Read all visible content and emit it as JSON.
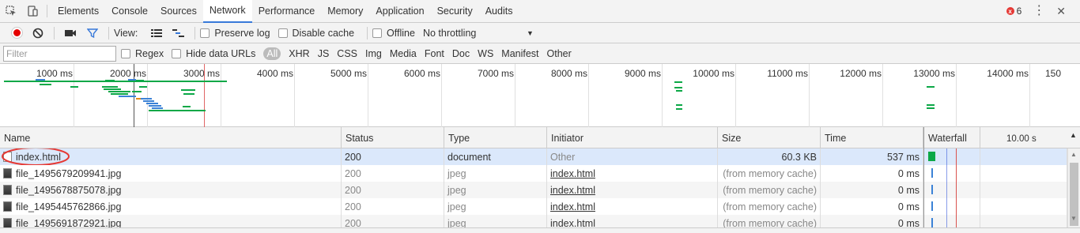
{
  "devtools_tabs": [
    "Elements",
    "Console",
    "Sources",
    "Network",
    "Performance",
    "Memory",
    "Application",
    "Security",
    "Audits"
  ],
  "active_tab": "Network",
  "error_count": "6",
  "error_mark": "x",
  "toolbar": {
    "view_label": "View:",
    "preserve_log": "Preserve log",
    "disable_cache": "Disable cache",
    "offline": "Offline",
    "throttling": "No throttling"
  },
  "filter": {
    "placeholder": "Filter",
    "regex": "Regex",
    "hide_data_urls": "Hide data URLs",
    "types": [
      "All",
      "XHR",
      "JS",
      "CSS",
      "Img",
      "Media",
      "Font",
      "Doc",
      "WS",
      "Manifest",
      "Other"
    ],
    "active_type": "All"
  },
  "overview": {
    "tick_labels": [
      "1000 ms",
      "2000 ms",
      "3000 ms",
      "4000 ms",
      "5000 ms",
      "6000 ms",
      "7000 ms",
      "8000 ms",
      "9000 ms",
      "10000 ms",
      "11000 ms",
      "12000 ms",
      "13000 ms",
      "14000 ms",
      "150"
    ]
  },
  "table": {
    "columns": [
      "Name",
      "Status",
      "Type",
      "Initiator",
      "Size",
      "Time",
      "Waterfall"
    ],
    "waterfall_scale": "10.00 s",
    "rows": [
      {
        "name": "index.html",
        "status": "200",
        "type": "document",
        "initiator": "Other",
        "size": "60.3 KB",
        "time": "537 ms",
        "kind": "doc",
        "selected": true
      },
      {
        "name": "file_1495679209941.jpg",
        "status": "200",
        "type": "jpeg",
        "initiator": "index.html",
        "size": "(from memory cache)",
        "time": "0 ms",
        "kind": "img"
      },
      {
        "name": "file_1495678875078.jpg",
        "status": "200",
        "type": "jpeg",
        "initiator": "index.html",
        "size": "(from memory cache)",
        "time": "0 ms",
        "kind": "img"
      },
      {
        "name": "file_1495445762866.jpg",
        "status": "200",
        "type": "jpeg",
        "initiator": "index.html",
        "size": "(from memory cache)",
        "time": "0 ms",
        "kind": "img"
      },
      {
        "name": "file_1495691872921.jpg",
        "status": "200",
        "type": "jpeg",
        "initiator": "index.html",
        "size": "(from memory cache)",
        "time": "0 ms",
        "kind": "img"
      }
    ]
  },
  "colors": {
    "accent": "#3879d9",
    "record": "#e50000",
    "error": "#e53935",
    "waiting": "#0ca847",
    "download": "#3b82d6",
    "dom_content_loaded": "#3b5bdb",
    "load": "#d9534f"
  }
}
